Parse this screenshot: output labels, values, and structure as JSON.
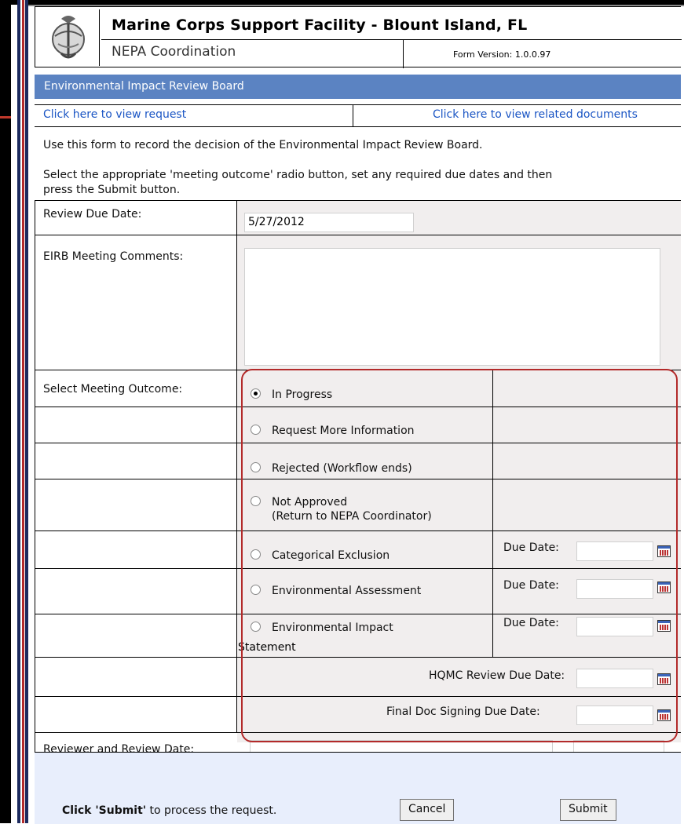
{
  "header": {
    "org_title": "Marine Corps Support Facility - Blount Island, FL",
    "subtitle": "NEPA Coordination",
    "version_label": "Form Version: 1.0.0.97"
  },
  "section_bar": "Environmental Impact Review Board",
  "links": {
    "view_request": "Click here to view request",
    "view_related": "Click here to view related documents"
  },
  "instructions": {
    "line1": "Use this form to record the decision of the Environmental Impact Review Board.",
    "line2a": "Select the appropriate 'meeting outcome' radio button, set any required due dates and then",
    "line2b": "press the Submit button."
  },
  "form": {
    "review_due_label": "Review Due Date:",
    "review_due_value": "5/27/2012",
    "comments_label": "EIRB Meeting Comments:",
    "comments_value": "",
    "outcome_label": "Select Meeting Outcome:",
    "options": [
      {
        "label": "In Progress",
        "checked": true
      },
      {
        "label": "Request More Information",
        "checked": false
      },
      {
        "label": "Rejected (Workflow ends)",
        "checked": false
      },
      {
        "label": "Not Approved",
        "sub": "(Return to NEPA Coordinator)",
        "checked": false
      },
      {
        "label": "Categorical Exclusion",
        "checked": false
      },
      {
        "label": "Environmental Assessment",
        "checked": false
      },
      {
        "label": "Environmental Impact",
        "sub": "Statement",
        "checked": false
      }
    ],
    "due_date_label": "Due Date:",
    "hqmc_label": "HQMC Review Due Date:",
    "final_label": "Final Doc Signing Due Date:",
    "reviewer_label": "Reviewer and Review Date:"
  },
  "footer": {
    "submit_hint_bold": "Click 'Submit'",
    "submit_hint_rest": " to process the request.",
    "cancel": "Cancel",
    "submit": "Submit"
  },
  "colors": {
    "section_bar": "#5b83c2",
    "link": "#1a55c4",
    "outline": "#b32a2a",
    "footer_bg": "#e8eefc"
  }
}
